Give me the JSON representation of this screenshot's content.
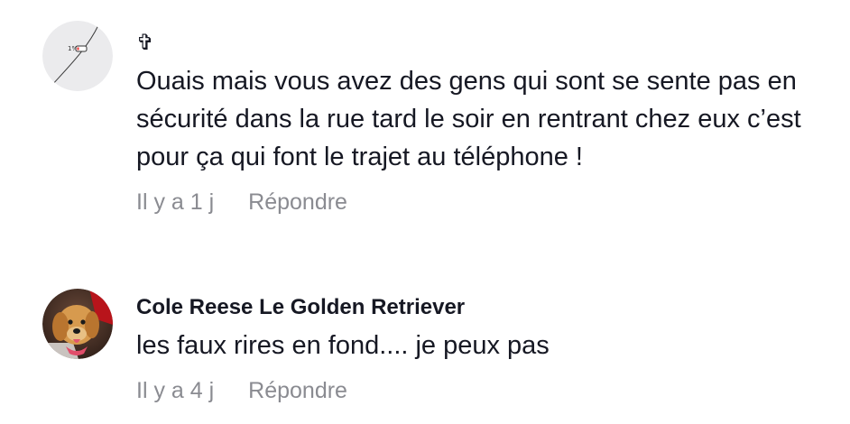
{
  "comments": [
    {
      "username": "✞",
      "avatar_icon": "logo-avatar-icon",
      "text": "Ouais mais vous avez des gens qui sont se sente pas en sécurité dans la rue tard le soir en rentrant chez eux c’est pour ça qui font le trajet au téléphone !",
      "time": "Il y a 1 j",
      "reply_label": "Répondre"
    },
    {
      "username": "Cole Reese Le Golden Retriever",
      "avatar_icon": "dog-avatar-icon",
      "text": "les faux rires en fond.... je peux pas",
      "time": "Il y a 4 j",
      "reply_label": "Répondre"
    }
  ],
  "colors": {
    "text_primary": "#161823",
    "text_secondary": "#8a8b91",
    "background": "#ffffff"
  }
}
